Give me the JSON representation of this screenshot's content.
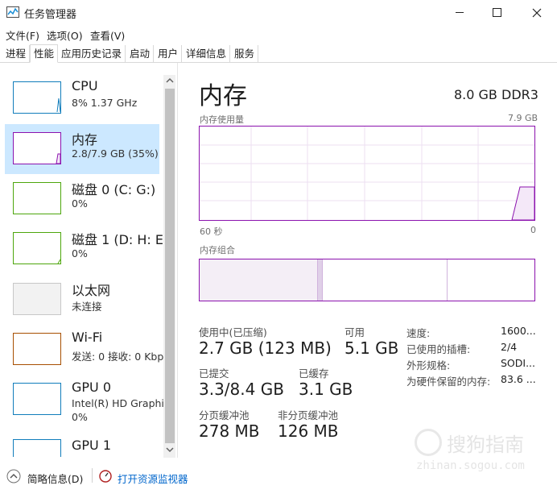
{
  "window": {
    "title": "任务管理器"
  },
  "menu": [
    "文件(F)",
    "选项(O)",
    "查看(V)"
  ],
  "tabs": [
    "进程",
    "性能",
    "应用历史记录",
    "启动",
    "用户",
    "详细信息",
    "服务"
  ],
  "sidebar": {
    "items": [
      {
        "name": "CPU",
        "sub1": "8% 1.37 GHz",
        "sub2": ""
      },
      {
        "name": "内存",
        "sub1": "2.8/7.9 GB (35%)",
        "sub2": ""
      },
      {
        "name": "磁盘 0 (C: G:)",
        "sub1": "0%",
        "sub2": ""
      },
      {
        "name": "磁盘 1 (D: H: E",
        "sub1": "0%",
        "sub2": ""
      },
      {
        "name": "以太网",
        "sub1": "未连接",
        "sub2": ""
      },
      {
        "name": "Wi-Fi",
        "sub1": "发送: 0 接收: 0 Kbp",
        "sub2": ""
      },
      {
        "name": "GPU 0",
        "sub1": "Intel(R) HD Graphic",
        "sub2": "0%"
      },
      {
        "name": "GPU 1",
        "sub1": "",
        "sub2": ""
      }
    ]
  },
  "main": {
    "title": "内存",
    "spec": "8.0 GB DDR3",
    "usage_label": "内存使用量",
    "usage_max": "7.9 GB",
    "axis_left": "60 秒",
    "axis_right": "0",
    "composition_label": "内存组合",
    "stats": {
      "in_use_label": "使用中(已压缩)",
      "in_use_value": "2.7 GB (123 MB)",
      "available_label": "可用",
      "available_value": "5.1 GB",
      "committed_label": "已提交",
      "committed_value": "3.3/8.4 GB",
      "cached_label": "已缓存",
      "cached_value": "3.1 GB",
      "paged_label": "分页缓冲池",
      "paged_value": "278 MB",
      "nonpaged_label": "非分页缓冲池",
      "nonpaged_value": "126 MB"
    },
    "details": [
      {
        "k": "速度:",
        "v": "1600..."
      },
      {
        "k": "已使用的插槽:",
        "v": "2/4"
      },
      {
        "k": "外形规格:",
        "v": "SODI..."
      },
      {
        "k": "为硬件保留的内存:",
        "v": "83.6 ..."
      }
    ]
  },
  "bottom": {
    "fewer_details": "简略信息(D)",
    "open_monitor": "打开资源监视器"
  },
  "watermark": {
    "text": "搜狗指南",
    "url": "zhinan.sogou.com"
  },
  "colors": {
    "memory": "#8b12ae",
    "cpu": "#117dbb",
    "disk": "#4da60c",
    "wifi": "#a74f01",
    "selected": "#cce8ff"
  }
}
